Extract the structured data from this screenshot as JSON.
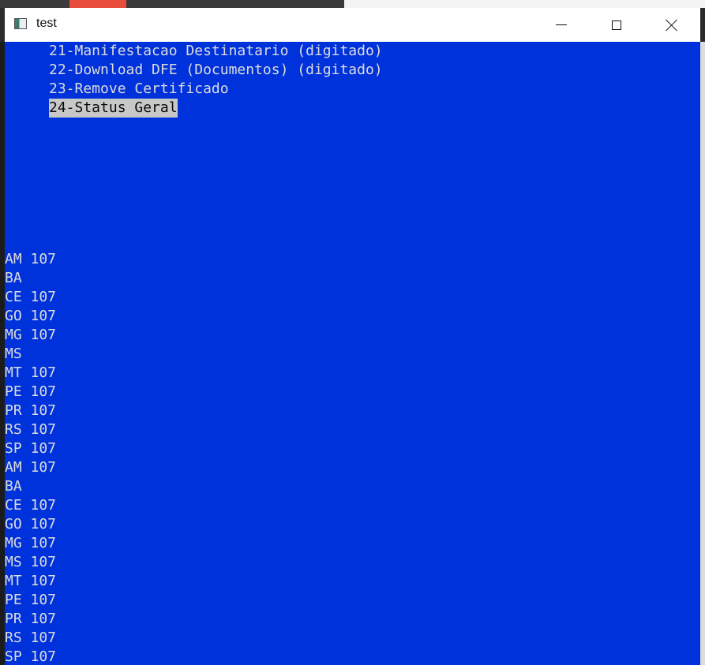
{
  "window": {
    "title": "test"
  },
  "menu": {
    "items": [
      "21-Manifestacao Destinatario (digitado)",
      "22-Download DFE (Documentos) (digitado)",
      "23-Remove Certificado"
    ],
    "selected": "24-Status Geral"
  },
  "status": {
    "lines": [
      "AM 107",
      "BA",
      "CE 107",
      "GO 107",
      "MG 107",
      "MS",
      "MT 107",
      "PE 107",
      "PR 107",
      "RS 107",
      "SP 107",
      "AM 107",
      "BA",
      "CE 107",
      "GO 107",
      "MG 107",
      "MS 107",
      "MT 107",
      "PE 107",
      "PR 107",
      "RS 107",
      "SP 107"
    ]
  },
  "colors": {
    "console_background": "#0032dc",
    "console_text": "#dcdcdc",
    "selection_background": "#c8c8c8"
  },
  "icons": {
    "app": "console-app-icon",
    "minimize": "minimize-icon",
    "maximize": "maximize-icon",
    "close": "close-icon"
  }
}
